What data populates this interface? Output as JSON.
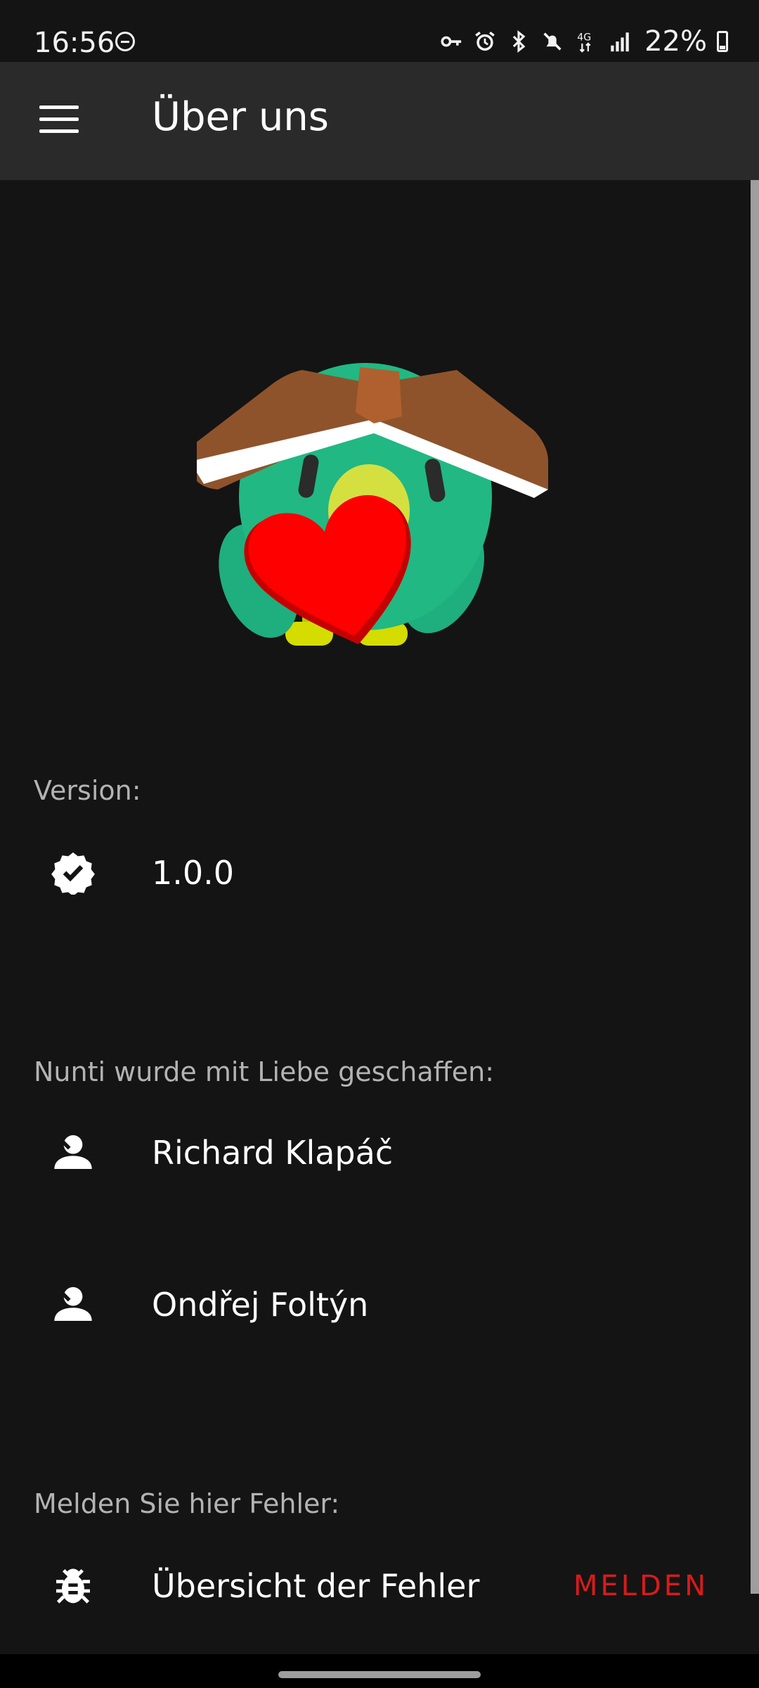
{
  "status_bar": {
    "time": "16:56",
    "battery_percent": "22%",
    "icons": [
      "do-not-disturb-icon",
      "vpn-key-icon",
      "alarm-icon",
      "bluetooth-icon",
      "mute-icon",
      "4g-data-icon",
      "signal-icon",
      "battery-icon"
    ]
  },
  "app_bar": {
    "title": "Über uns",
    "menu_icon": "hamburger-menu-icon"
  },
  "version_section": {
    "header": "Version:",
    "value": "1.0.0",
    "icon": "verified-badge-icon"
  },
  "authors_section": {
    "header": "Nunti wurde mit Liebe geschaffen:",
    "authors": [
      {
        "name": "Richard Klapáč",
        "icon": "person-icon"
      },
      {
        "name": "Ondřej Foltýn",
        "icon": "person-icon"
      }
    ]
  },
  "bugs_section": {
    "header": "Melden Sie hier Fehler:",
    "item_label": "Übersicht der Fehler",
    "action_label": "MELDEN",
    "icon": "bug-icon"
  },
  "colors": {
    "background": "#141414",
    "app_bar": "#2a2a2a",
    "accent_red": "#d81b1b",
    "secondary_text": "#b3b3b3"
  }
}
